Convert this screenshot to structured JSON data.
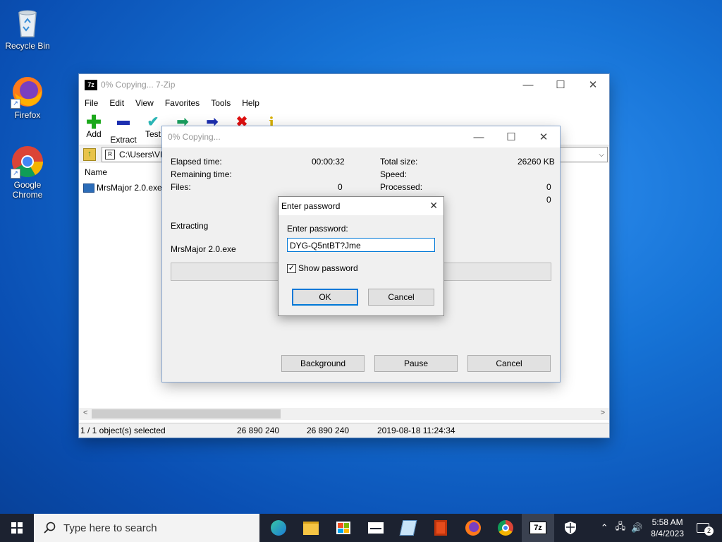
{
  "desktop": {
    "icons": [
      {
        "label": "Recycle Bin",
        "icon": "recycle-bin-icon"
      },
      {
        "label": "Firefox",
        "icon": "firefox-icon"
      },
      {
        "label": "Google Chrome",
        "icon": "chrome-icon"
      }
    ]
  },
  "main_window": {
    "title": "0% Copying... 7-Zip",
    "menu": [
      "File",
      "Edit",
      "View",
      "Favorites",
      "Tools",
      "Help"
    ],
    "toolbar": [
      {
        "label": "Add",
        "icon": "plus-icon",
        "color": "#1aa81a"
      },
      {
        "label": "Extract",
        "icon": "minus-icon",
        "color": "#1c2fb0"
      },
      {
        "label": "Test",
        "icon": "check-icon",
        "color": "#2bb5b5"
      },
      {
        "label": "",
        "icon": "copy-arrow-icon",
        "color": "#1aa060"
      },
      {
        "label": "",
        "icon": "move-arrow-icon",
        "color": "#1c2fb0"
      },
      {
        "label": "",
        "icon": "delete-x-icon",
        "color": "#e01010"
      },
      {
        "label": "",
        "icon": "info-icon",
        "color": "#d8b000"
      }
    ],
    "address": "C:\\Users\\VM",
    "column_name": "Name",
    "file": "MrsMajor 2.0.exe",
    "status": {
      "selected": "1 / 1 object(s) selected",
      "size": "26 890 240",
      "packed": "26 890 240",
      "modified": "2019-08-18 11:24:34"
    }
  },
  "progress_dialog": {
    "title": "0% Copying...",
    "elapsed_label": "Elapsed time:",
    "elapsed_value": "00:00:32",
    "remaining_label": "Remaining time:",
    "files_label": "Files:",
    "files_value": "0",
    "total_label": "Total size:",
    "total_value": "26260 KB",
    "speed_label": "Speed:",
    "processed_label": "Processed:",
    "processed_value": "0",
    "extra_value": "0",
    "action": "Extracting",
    "current_file": "MrsMajor 2.0.exe",
    "buttons": {
      "background": "Background",
      "pause": "Pause",
      "cancel": "Cancel"
    }
  },
  "password_dialog": {
    "title": "Enter password",
    "prompt": "Enter password:",
    "value": "DYG-Q5ntBT?Jme",
    "show_password_label": "Show password",
    "show_password_checked": true,
    "ok": "OK",
    "cancel": "Cancel"
  },
  "taskbar": {
    "search_placeholder": "Type here to search",
    "apps": [
      "edge-icon",
      "file-explorer-icon",
      "store-icon",
      "mail-icon",
      "notepad-icon",
      "office-icon",
      "firefox-icon",
      "chrome-icon",
      "7zip-icon",
      "security-icon"
    ],
    "time": "5:58 AM",
    "date": "8/4/2023",
    "notifications": "2"
  }
}
